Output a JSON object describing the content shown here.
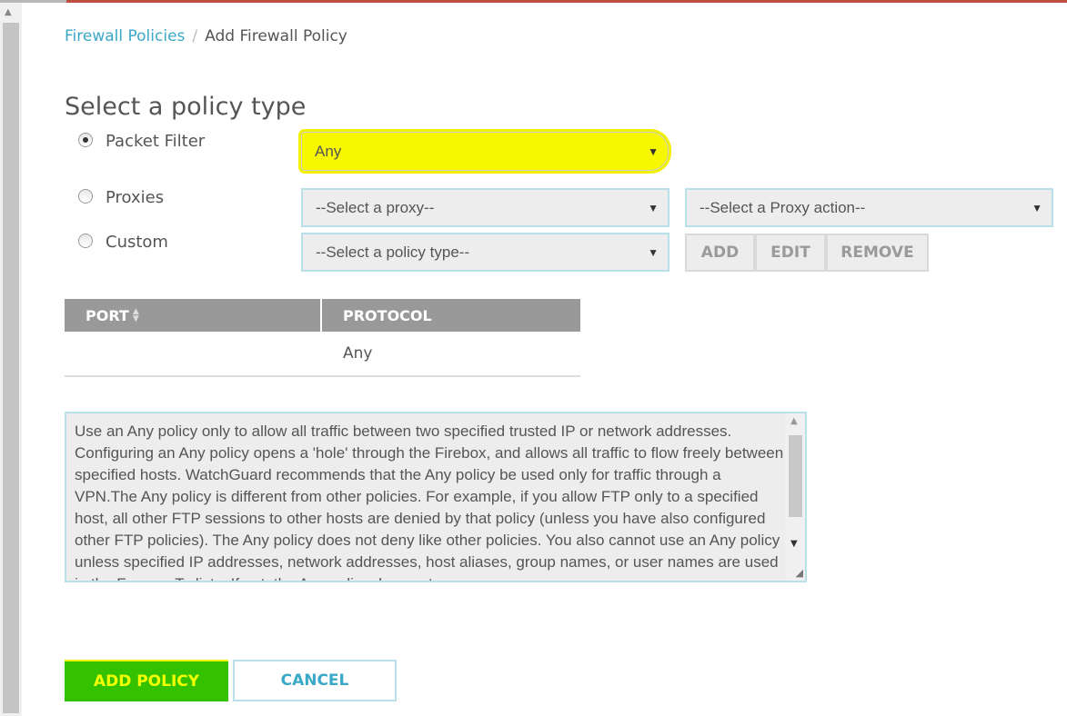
{
  "breadcrumb": {
    "parent": "Firewall Policies",
    "separator": "/",
    "current": "Add Firewall Policy"
  },
  "title": "Select a policy type",
  "policy_types": [
    {
      "label": "Packet Filter",
      "checked": true
    },
    {
      "label": "Proxies",
      "checked": false
    },
    {
      "label": "Custom",
      "checked": false
    }
  ],
  "packet_filter_select": {
    "value": "Any",
    "caret": "▼"
  },
  "proxy_select": {
    "value": "--Select a proxy--",
    "caret": "▼"
  },
  "proxy_action_select": {
    "value": "--Select a Proxy action--",
    "caret": "▼"
  },
  "custom_policy_select": {
    "value": "--Select a policy type--",
    "caret": "▼"
  },
  "custom_buttons": {
    "add": "ADD",
    "edit": "EDIT",
    "remove": "REMOVE"
  },
  "table": {
    "headers": {
      "port": "PORT",
      "protocol": "PROTOCOL"
    },
    "rows": [
      {
        "port": "",
        "protocol": "Any"
      }
    ]
  },
  "description": "Use an Any policy only to allow all traffic between two specified trusted IP or network addresses. Configuring an Any policy opens a 'hole' through the Firebox, and allows all traffic to flow freely between specified hosts. WatchGuard recommends that the Any policy be used only for traffic through a VPN.The Any policy is different from other policies. For example, if you allow FTP only to a specified host, all other FTP sessions to other hosts are denied by that policy (unless you have also configured other FTP policies). The Any policy does not deny like other policies. You also cannot use an Any policy unless specified IP addresses, network addresses, host aliases, group names, or user names are used in the From or To lists. If not, the Any policy does not",
  "actions": {
    "add_policy": "ADD POLICY",
    "cancel": "CANCEL"
  },
  "colors": {
    "accent": "#3aa8c7",
    "highlight_yellow": "#f7f700",
    "add_green": "#34c200",
    "table_header": "#999999"
  }
}
